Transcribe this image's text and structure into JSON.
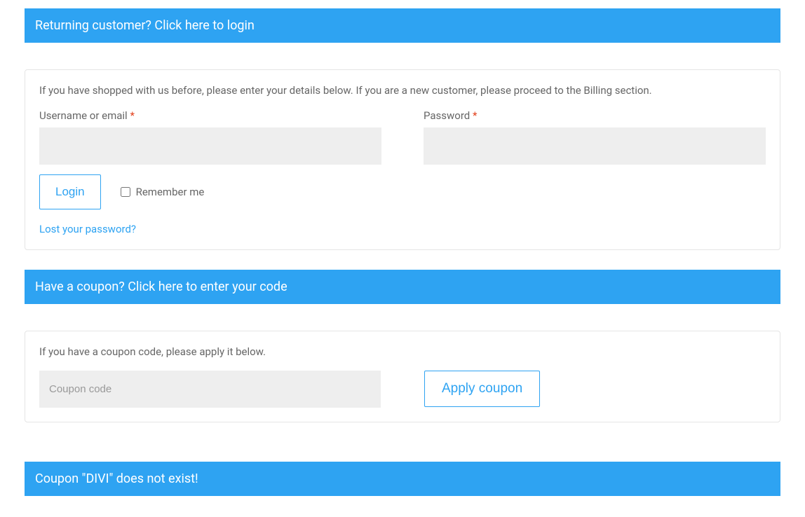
{
  "login_banner": {
    "prefix": "Returning customer?",
    "link": "Click here to login"
  },
  "login_panel": {
    "intro": "If you have shopped with us before, please enter your details below. If you are a new customer, please proceed to the Billing section.",
    "username_label": "Username or email",
    "password_label": "Password",
    "required_mark": "*",
    "login_button": "Login",
    "remember_label": "Remember me",
    "lost_password": "Lost your password?"
  },
  "coupon_banner": {
    "prefix": "Have a coupon?",
    "link": "Click here to enter your code"
  },
  "coupon_panel": {
    "intro": "If you have a coupon code, please apply it below.",
    "placeholder": "Coupon code",
    "apply_button": "Apply coupon"
  },
  "error_banner": {
    "text": "Coupon \"DIVI\" does not exist!"
  }
}
